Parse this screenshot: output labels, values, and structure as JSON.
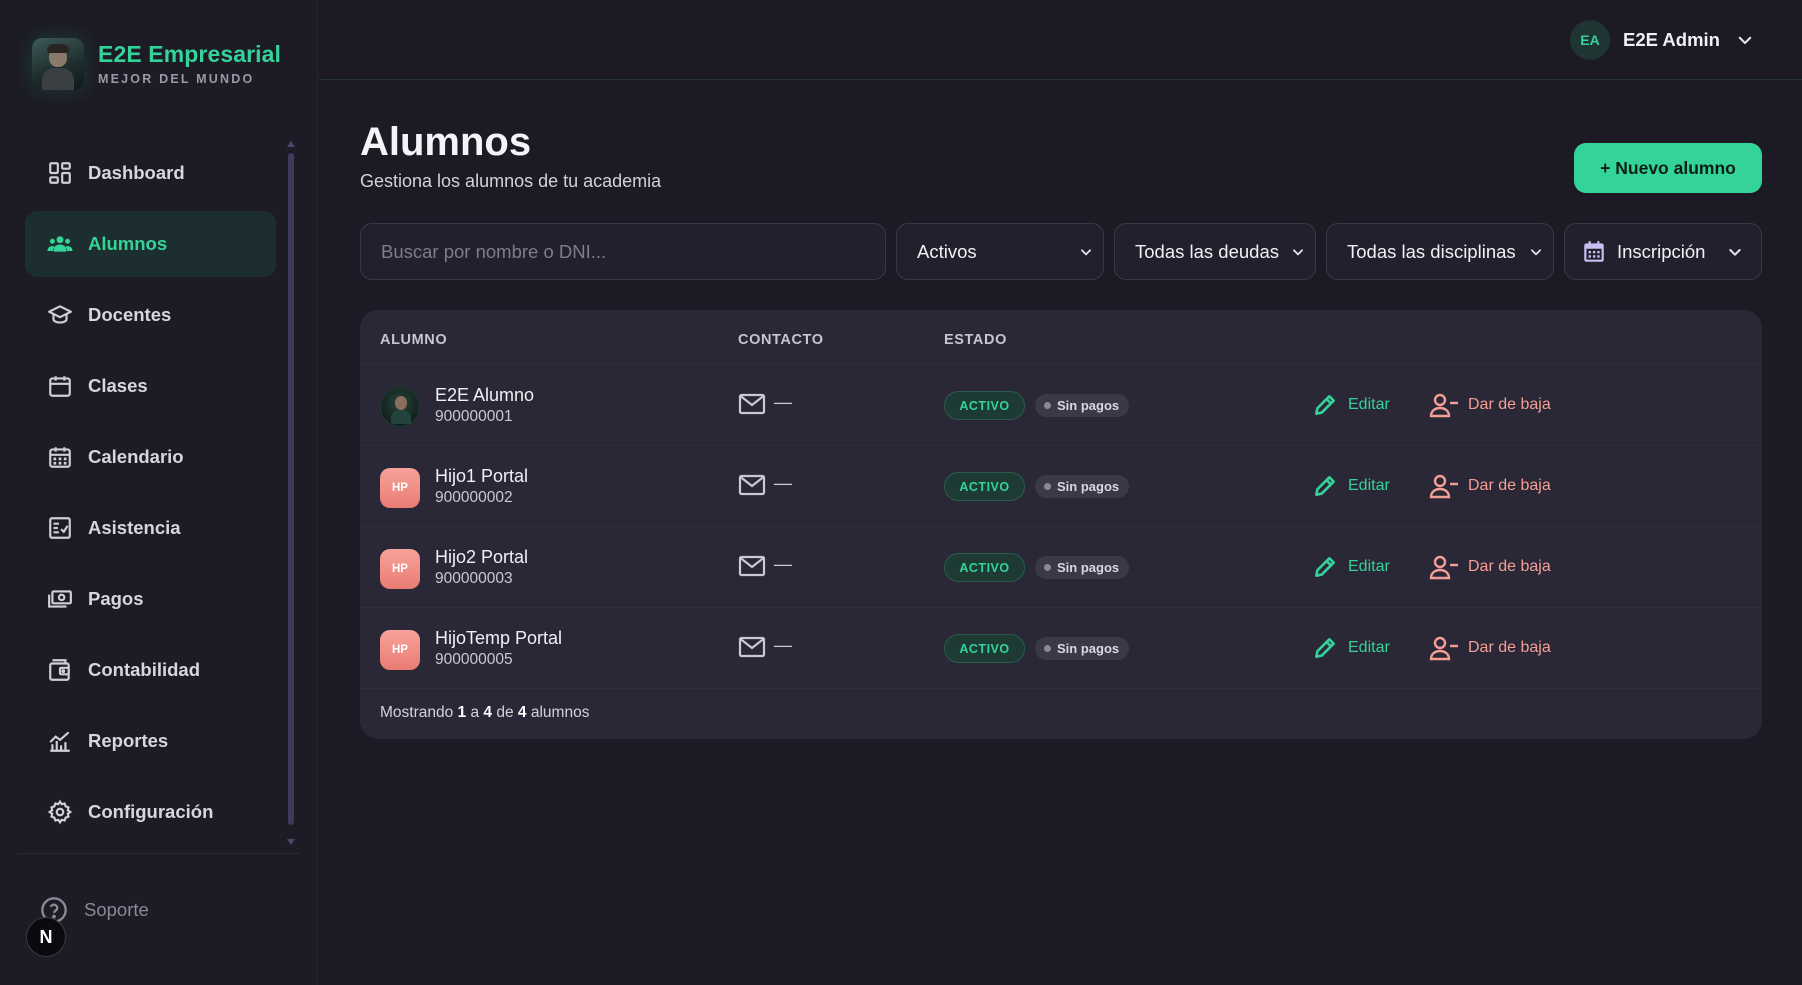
{
  "brand": {
    "title": "E2E Empresarial",
    "subtitle": "MEJOR DEL MUNDO"
  },
  "sidebar": {
    "items": [
      {
        "label": "Dashboard",
        "icon": "dashboard-icon",
        "active": false
      },
      {
        "label": "Alumnos",
        "icon": "users-icon",
        "active": true
      },
      {
        "label": "Docentes",
        "icon": "graduation-cap-icon",
        "active": false
      },
      {
        "label": "Clases",
        "icon": "calendar-blank-icon",
        "active": false
      },
      {
        "label": "Calendario",
        "icon": "calendar-grid-icon",
        "active": false
      },
      {
        "label": "Asistencia",
        "icon": "checklist-icon",
        "active": false
      },
      {
        "label": "Pagos",
        "icon": "money-icon",
        "active": false
      },
      {
        "label": "Contabilidad",
        "icon": "wallet-icon",
        "active": false
      },
      {
        "label": "Reportes",
        "icon": "chart-icon",
        "active": false
      },
      {
        "label": "Configuración",
        "icon": "gear-icon",
        "active": false
      }
    ],
    "support_label": "Soporte",
    "dev_badge": "N"
  },
  "topbar": {
    "user_initials": "EA",
    "user_name": "E2E Admin"
  },
  "page": {
    "title": "Alumnos",
    "subtitle": "Gestiona los alumnos de tu academia",
    "new_button": "+ Nuevo alumno"
  },
  "filters": {
    "search_placeholder": "Buscar por nombre o DNI...",
    "estado": "Activos",
    "deudas": "Todas las deudas",
    "disciplinas": "Todas las disciplinas",
    "orden": "Inscripción"
  },
  "table": {
    "headers": {
      "alumno": "ALUMNO",
      "contacto": "CONTACTO",
      "estado": "ESTADO"
    },
    "rows": [
      {
        "initials": "",
        "name": "E2E Alumno",
        "dni": "900000001",
        "contact": "—",
        "status": "ACTIVO",
        "payments": "Sin pagos",
        "edit": "Editar",
        "remove": "Dar de baja"
      },
      {
        "initials": "HP",
        "name": "Hijo1 Portal",
        "dni": "900000002",
        "contact": "—",
        "status": "ACTIVO",
        "payments": "Sin pagos",
        "edit": "Editar",
        "remove": "Dar de baja"
      },
      {
        "initials": "HP",
        "name": "Hijo2 Portal",
        "dni": "900000003",
        "contact": "—",
        "status": "ACTIVO",
        "payments": "Sin pagos",
        "edit": "Editar",
        "remove": "Dar de baja"
      },
      {
        "initials": "HP",
        "name": "HijoTemp Portal",
        "dni": "900000005",
        "contact": "—",
        "status": "ACTIVO",
        "payments": "Sin pagos",
        "edit": "Editar",
        "remove": "Dar de baja"
      }
    ],
    "footer": {
      "prefix": "Mostrando",
      "from": "1",
      "sep1": "a",
      "to": "4",
      "sep2": "de",
      "total": "4",
      "suffix": "alumnos"
    }
  },
  "colors": {
    "accent": "#34d399",
    "danger": "#f59e95",
    "background": "#1b1a25",
    "card": "#2a2837"
  }
}
